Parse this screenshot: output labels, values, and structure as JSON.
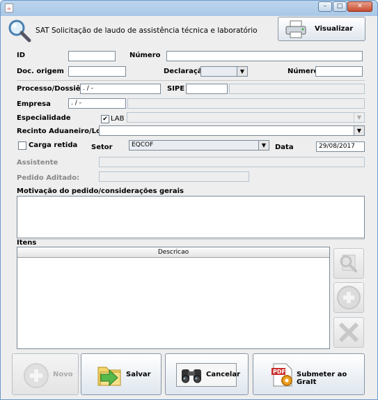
{
  "window": {
    "java_icon": "java-icon",
    "minimize_glyph": "–",
    "maximize_glyph": "□",
    "close_glyph": "✕"
  },
  "header": {
    "icon": "magnifier-icon",
    "title": "SAT Solicitação de laudo de assistência técnica e laboratório",
    "visualizar_label": "Visualizar",
    "visualizar_icon": "printer-icon"
  },
  "form": {
    "id_label": "ID",
    "id_value": "",
    "numero_label": "Número",
    "numero_value": "",
    "doc_origem_label": "Doc. origem",
    "doc_origem_value": "",
    "declaracao_label": "Declaração",
    "declaracao_value": "",
    "numero2_label": "Número",
    "numero2_value": "",
    "processo_label": "Processo/Dossiê",
    "processo_value": "  .    /  -",
    "sipe_label": "SIPE",
    "sipe_value": "",
    "empresa_label": "Empresa",
    "empresa_value": "  .  /  -",
    "especialidade_label": "Especialidade",
    "lab_label": "LAB",
    "lab_checked": true,
    "recinto_label": "Recinto Aduaneiro/Local",
    "recinto_value": "",
    "carga_retida_label": "Carga retida",
    "carga_retida_checked": false,
    "setor_label": "Setor",
    "setor_value": "EQCOF",
    "data_label": "Data",
    "data_value": "29/08/2017",
    "assistente_label": "Assistente",
    "pedido_aditado_label": "Pedido Aditado:",
    "motivacao_label": "Motivação do pedido/considerações gerais"
  },
  "itens": {
    "label": "Itens",
    "columns": [
      "Descricao"
    ],
    "rows": [],
    "side_icons": [
      "search-icon",
      "add-icon",
      "remove-icon"
    ]
  },
  "actions": {
    "novo_label": "Novo",
    "salvar_label": "Salvar",
    "cancelar_label": "Cancelar",
    "submeter_label": "Submeter ao GraIt"
  },
  "colors": {
    "title_gradient_top": "#bcd5ee",
    "panel_bg": "#eeeeee",
    "close_button": "#c74a2e"
  }
}
